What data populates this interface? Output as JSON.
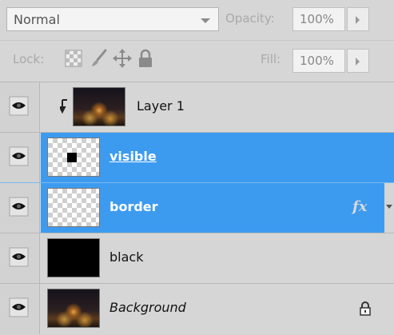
{
  "blend": {
    "mode": "Normal",
    "opacity_label": "Opacity:",
    "opacity_value": "100%"
  },
  "lock": {
    "label": "Lock:",
    "fill_label": "Fill:",
    "fill_value": "100%"
  },
  "layers": [
    {
      "name": "Layer 1",
      "thumb": "photo",
      "clipped": true,
      "selected": false
    },
    {
      "name": "visible",
      "thumb": "checker-with-black-square",
      "selected": true
    },
    {
      "name": "border",
      "thumb": "checker",
      "selected": true,
      "fx_label": "fx"
    },
    {
      "name": "black",
      "thumb": "black",
      "selected": false
    },
    {
      "name": "Background",
      "thumb": "photo",
      "selected": false,
      "locked": true
    }
  ],
  "colors": {
    "panel": "#d6d6d6",
    "selection": "#3d9bef"
  }
}
